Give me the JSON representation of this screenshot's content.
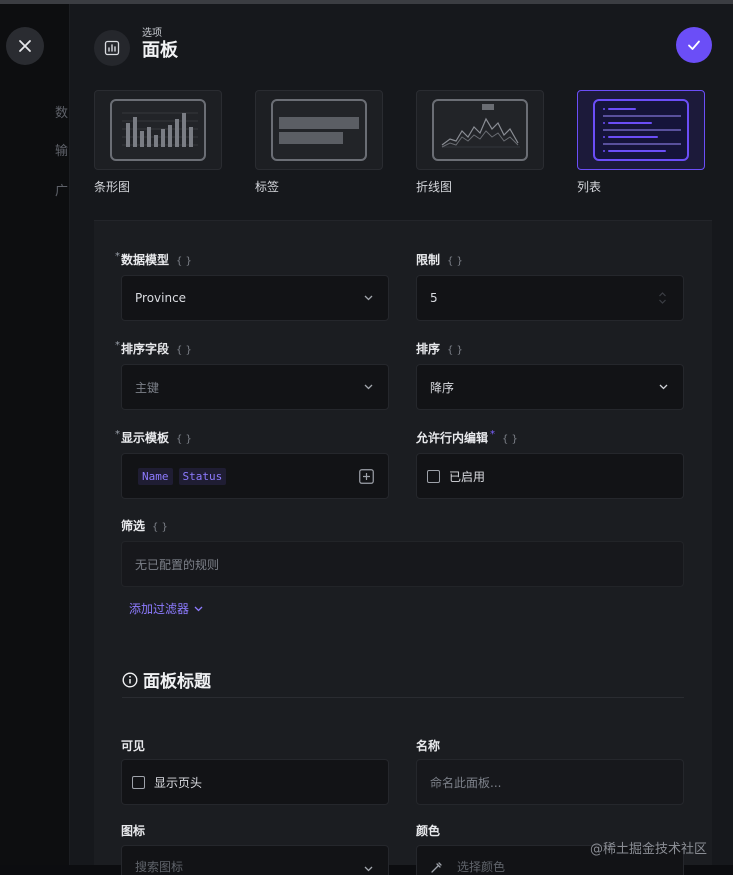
{
  "header": {
    "small": "选项",
    "title": "面板"
  },
  "background_letters": [
    "数",
    "输",
    "广"
  ],
  "visualizations": [
    {
      "label": "条形图",
      "name": "bar-chart",
      "selected": false
    },
    {
      "label": "标签",
      "name": "tag",
      "selected": false
    },
    {
      "label": "折线图",
      "name": "line-chart",
      "selected": false
    },
    {
      "label": "列表",
      "name": "list",
      "selected": true
    }
  ],
  "form": {
    "data_model": {
      "label": "数据模型",
      "value": "Province"
    },
    "limit": {
      "label": "限制",
      "value": "5"
    },
    "sort_field": {
      "label": "排序字段",
      "placeholder": "主键"
    },
    "sort": {
      "label": "排序",
      "value": "降序"
    },
    "display_template": {
      "label": "显示模板",
      "tags": [
        "Name",
        "Status"
      ]
    },
    "inline_edit": {
      "label": "允许行内编辑",
      "checkbox_label": "已启用"
    },
    "filter": {
      "label": "筛选",
      "empty_text": "无已配置的规则",
      "add_label": "添加过滤器"
    }
  },
  "panel_title_section": {
    "title": "面板标题",
    "visible": {
      "label": "可见",
      "checkbox_label": "显示页头"
    },
    "name": {
      "label": "名称",
      "placeholder": "命名此面板..."
    },
    "icon": {
      "label": "图标",
      "placeholder": "搜索图标"
    },
    "color": {
      "label": "颜色",
      "placeholder": "选择颜色"
    }
  },
  "watermark": "@稀土掘金技术社区",
  "colors": {
    "accent": "#6b4ef7",
    "panel": "#16181c",
    "form": "#1b1d21",
    "input": "#121316"
  }
}
